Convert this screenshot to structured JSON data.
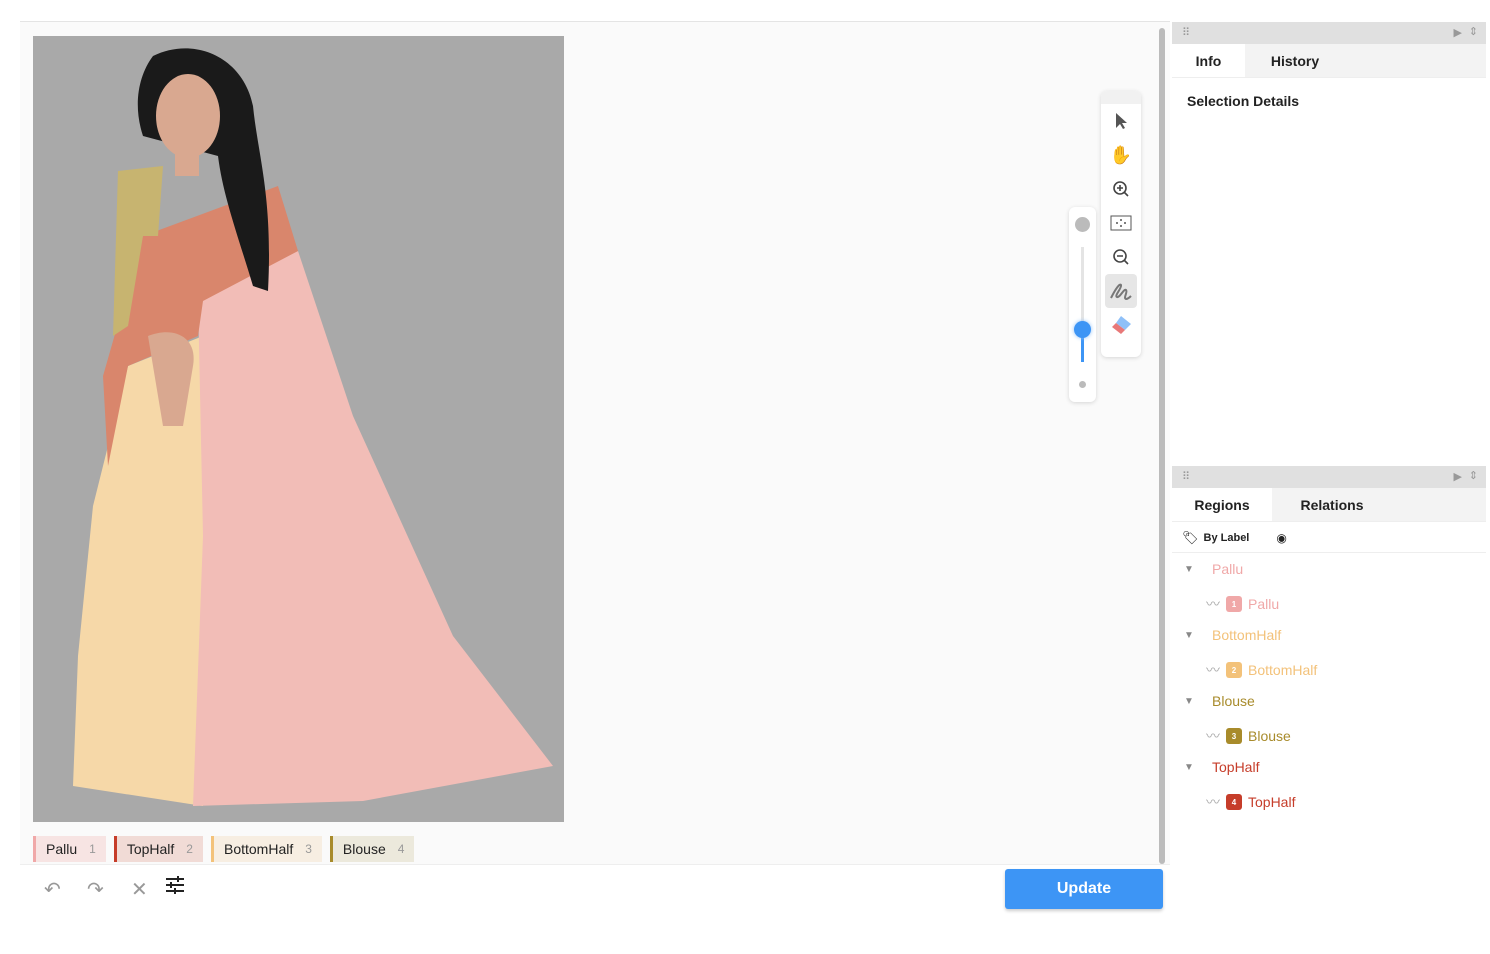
{
  "labels_bar": [
    {
      "name": "Pallu",
      "num": "1",
      "color": "#f0a8a8",
      "bg": "#f7e4e3"
    },
    {
      "name": "TopHalf",
      "num": "2",
      "color": "#c63d2a",
      "bg": "#f1dbd6"
    },
    {
      "name": "BottomHalf",
      "num": "3",
      "color": "#f3c27a",
      "bg": "#f7eee2"
    },
    {
      "name": "Blouse",
      "num": "4",
      "color": "#a88b2b",
      "bg": "#ece9dc"
    }
  ],
  "toolbar": {
    "update_label": "Update",
    "icons": [
      "undo-icon",
      "redo-icon",
      "close-icon",
      "settings-sliders-icon"
    ]
  },
  "canvas_tools": [
    "pointer-icon",
    "hand-icon",
    "zoom-in-icon",
    "fit-icon",
    "zoom-out-icon",
    "brush-icon",
    "eraser-icon"
  ],
  "zoom_slider": {
    "value": 0.28,
    "accent": "#3d95f5"
  },
  "info_panel": {
    "tabs": [
      "Info",
      "History"
    ],
    "active_tab": "Info",
    "heading": "Selection Details"
  },
  "regions_panel": {
    "tabs": [
      "Regions",
      "Relations"
    ],
    "active_tab": "Regions",
    "group_by_label": "By Label",
    "groups": [
      {
        "label": "Pallu",
        "color": "#f0a8a8",
        "items": [
          {
            "num": "1",
            "label": "Pallu"
          }
        ]
      },
      {
        "label": "BottomHalf",
        "color": "#f3c27a",
        "items": [
          {
            "num": "2",
            "label": "BottomHalf"
          }
        ]
      },
      {
        "label": "Blouse",
        "color": "#a88b2b",
        "items": [
          {
            "num": "3",
            "label": "Blouse"
          }
        ]
      },
      {
        "label": "TopHalf",
        "color": "#c63d2a",
        "items": [
          {
            "num": "4",
            "label": "TopHalf"
          }
        ]
      }
    ]
  }
}
